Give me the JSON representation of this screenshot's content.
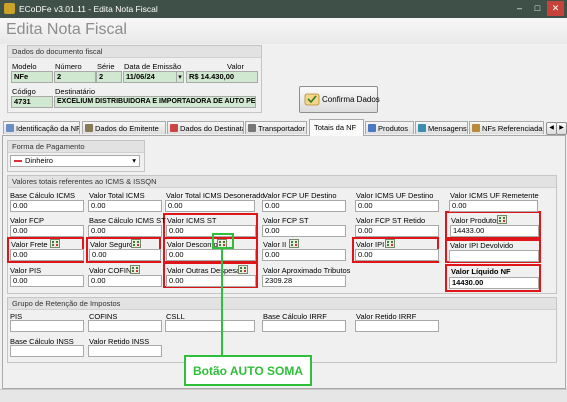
{
  "window": {
    "title": "ECoDFe v3.01.11 - Edita Nota Fiscal",
    "app_icon": "app-icon",
    "minimize": "–",
    "maximize": "□",
    "close": "✕"
  },
  "heading": "Edita Nota Fiscal",
  "document": {
    "title": "Dados do documento fiscal",
    "modelo": {
      "label": "Modelo",
      "value": "NFe"
    },
    "numero": {
      "label": "Número",
      "value": "2"
    },
    "serie": {
      "label": "Série",
      "value": "2"
    },
    "data_emissao": {
      "label": "Data de Emissão",
      "value": "11/06/24"
    },
    "valor": {
      "label": "Valor",
      "value": "R$ 14.430,00"
    },
    "codigo": {
      "label": "Código",
      "value": "4731"
    },
    "destinatario": {
      "label": "Destinatário",
      "value": "EXCELIUM DISTRIBUIDORA E IMPORTADORA DE AUTO PEC"
    }
  },
  "confirm_button": {
    "label": "Confirma Dados",
    "icon": "hand-check-icon"
  },
  "tabs": [
    {
      "label": "Identificação da NF",
      "icon": "document-icon"
    },
    {
      "label": "Dados do Emitente",
      "icon": "building-icon"
    },
    {
      "label": "Dados do Destinatário",
      "icon": "user-card-icon"
    },
    {
      "label": "Transportador",
      "icon": "truck-icon"
    },
    {
      "label": "Totais da NF",
      "icon": ""
    },
    {
      "label": "Produtos",
      "icon": "box-icon"
    },
    {
      "label": "Mensagens",
      "icon": "message-icon"
    },
    {
      "label": "NFs Referenciadas",
      "icon": "document-link-icon"
    }
  ],
  "payment": {
    "title": "Forma de Pagamento",
    "selected": "Dinheiro",
    "arrow": "▾"
  },
  "icms": {
    "title": "Valores totais referentes ao ICMS & ISSQN",
    "base_calculo_icms": {
      "label": "Base Cálculo ICMS",
      "value": "0.00"
    },
    "valor_total_icms": {
      "label": "Valor Total ICMS",
      "value": "0.00"
    },
    "valor_total_icms_desonerado": {
      "label": "Valor Total ICMS Desonerado",
      "value": "0.00"
    },
    "valor_fcp_uf_destino": {
      "label": "Valor FCP UF Destino",
      "value": "0.00"
    },
    "valor_icms_uf_destino": {
      "label": "Valor ICMS UF Destino",
      "value": "0.00"
    },
    "valor_icms_uf_remetente": {
      "label": "Valor ICMS UF Remetente",
      "value": "0.00"
    },
    "valor_fcp": {
      "label": "Valor FCP",
      "value": "0.00"
    },
    "base_calculo_icms_st": {
      "label": "Base Cálculo ICMS ST",
      "value": "0.00"
    },
    "valor_icms_st": {
      "label": "Valor ICMS ST",
      "value": "0.00"
    },
    "valor_fcp_st": {
      "label": "Valor FCP ST",
      "value": "0.00"
    },
    "valor_fcp_st_retido": {
      "label": "Valor FCP ST Retido",
      "value": "0.00"
    },
    "valor_produtos": {
      "label": "Valor Produtos",
      "value": "14433.00"
    },
    "valor_frete": {
      "label": "Valor Frete",
      "value": "0.00"
    },
    "valor_seguro": {
      "label": "Valor Seguro",
      "value": "0.00"
    },
    "valor_desconto": {
      "label": "Valor Desconto",
      "value": "0.00"
    },
    "valor_ii": {
      "label": "Valor II",
      "value": "0.00"
    },
    "valor_ipi": {
      "label": "Valor IPI",
      "value": "0.00"
    },
    "valor_ipi_devolvido": {
      "label": "Valor IPI Devolvido",
      "value": ""
    },
    "valor_pis": {
      "label": "Valor PIS",
      "value": "0.00"
    },
    "valor_cofins": {
      "label": "Valor COFINS",
      "value": "0.00"
    },
    "valor_outras_despesas": {
      "label": "Valor Outras Despesas",
      "value": "0.00"
    },
    "valor_aproximado_tributos": {
      "label": "Valor Aproximado Tributos",
      "value": "2309.28"
    },
    "valor_liquido_nf": {
      "label": "Valor Líquido NF",
      "value": "14430.00"
    }
  },
  "retention": {
    "title": "Grupo de Retenção de Impostos",
    "pis": {
      "label": "PIS",
      "value": ""
    },
    "cofins": {
      "label": "COFINS",
      "value": ""
    },
    "csll": {
      "label": "CSLL",
      "value": ""
    },
    "base_calculo_irrf": {
      "label": "Base Cálculo IRRF",
      "value": ""
    },
    "valor_retido_irrf": {
      "label": "Valor Retido IRRF",
      "value": ""
    },
    "base_calculo_inss": {
      "label": "Base Cálculo INSS",
      "value": ""
    },
    "valor_retido_inss": {
      "label": "Valor Retido INSS",
      "value": ""
    }
  },
  "annotation": {
    "label": "Botão AUTO SOMA"
  },
  "colors": {
    "highlight": "#e0151a",
    "annotation": "#2fbf3a",
    "title_bar": "#3f5049",
    "readonly_field": "#cfe8cf"
  }
}
